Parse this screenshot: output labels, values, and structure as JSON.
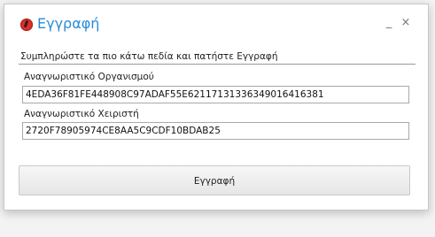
{
  "window": {
    "title": "Εγγραφή",
    "icon": "app-logo-icon",
    "minimize_glyph": "_",
    "close_glyph": "×"
  },
  "form": {
    "instruction": "Συμπληρώστε τα πιο κάτω πεδία και πατήστε Εγγραφή",
    "organization_id": {
      "label": "Αναγνωριστικό Οργανισμού",
      "value": "4EDA36F81FE448908C97ADAF55E62117131336349016416381"
    },
    "user_id": {
      "label": "Αναγνωριστικό Χειριστή",
      "value": "2720F78905974CE8AA5C9CDF10BDAB25"
    },
    "submit_label": "Εγγραφή"
  },
  "colors": {
    "title": "#2a8bd6",
    "icon": "#d9302c"
  }
}
